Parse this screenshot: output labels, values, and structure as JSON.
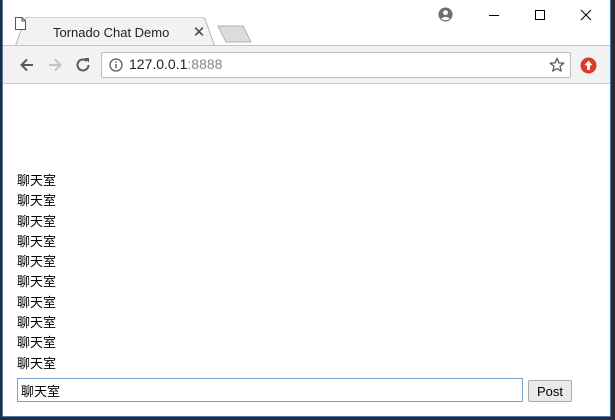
{
  "browser": {
    "tab": {
      "title": "Tornado Chat Demo"
    },
    "address": {
      "host": "127.0.0.1",
      "port": ":8888"
    }
  },
  "chat": {
    "messages": [
      "聊天室",
      "聊天室",
      "聊天室",
      "聊天室",
      "聊天室",
      "聊天室",
      "聊天室",
      "聊天室",
      "聊天室",
      "聊天室"
    ],
    "input_value": "聊天室",
    "post_label": "Post"
  },
  "colors": {
    "focus_border": "#7da2ce",
    "extension_badge": "#d93a2b",
    "window_border": "#4a7ab3"
  },
  "icons": [
    "page-icon",
    "close-icon",
    "profile-icon",
    "minimize-icon",
    "maximize-icon",
    "window-close-icon",
    "back-icon",
    "forward-icon",
    "reload-icon",
    "info-icon",
    "star-icon",
    "extension-icon"
  ]
}
